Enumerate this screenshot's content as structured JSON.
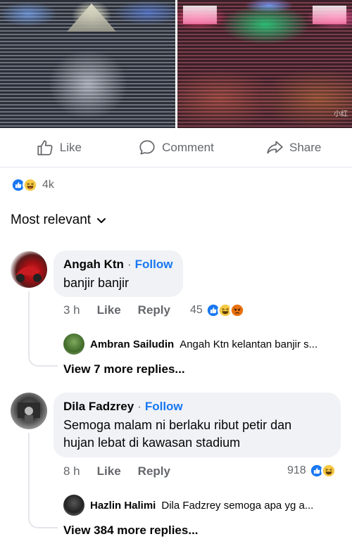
{
  "photos": {
    "right_watermark": "小红"
  },
  "actions": {
    "like": "Like",
    "comment": "Comment",
    "share": "Share"
  },
  "reactions_summary": {
    "count": "4k",
    "icons": [
      "like-reaction-icon",
      "haha-reaction-icon"
    ]
  },
  "sort": {
    "label": "Most relevant"
  },
  "comments": [
    {
      "author": "Angah Ktn",
      "follow": "Follow",
      "separator": "·",
      "text": "banjir banjir",
      "time": "3 h",
      "like": "Like",
      "reply": "Reply",
      "reaction_count": "45",
      "reply_preview": {
        "author": "Ambran Sailudin",
        "text": "Angah Ktn kelantan banjir s..."
      },
      "view_more": "View 7 more replies..."
    },
    {
      "author": "Dila Fadzrey",
      "follow": "Follow",
      "separator": "·",
      "text": "Semoga malam ni berlaku ribut petir dan hujan lebat di kawasan stadium",
      "time": "8 h",
      "like": "Like",
      "reply": "Reply",
      "reaction_count": "918",
      "reply_preview": {
        "author": "Hazlin Halimi",
        "text": "Dila Fadzrey semoga apa yg a..."
      },
      "view_more": "View 384 more replies..."
    }
  ],
  "colors": {
    "accent": "#1877f2",
    "muted": "#65676b",
    "bubble": "#f0f2f5"
  }
}
